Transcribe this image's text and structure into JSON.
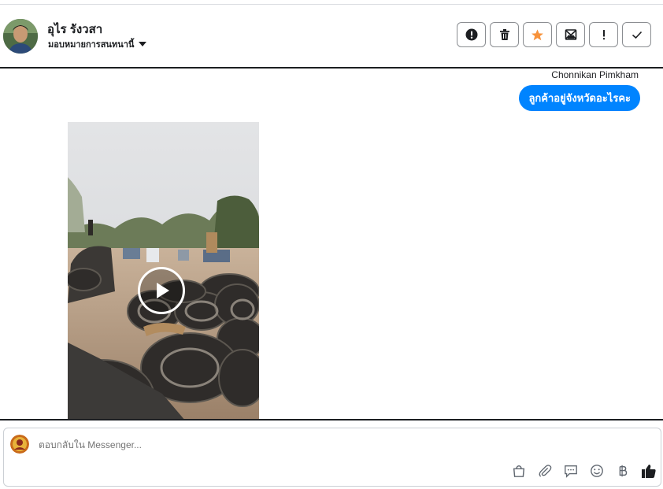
{
  "header": {
    "contact_name": "อุไร รังวสา",
    "assign_label": "มอบหมายการสนทนานี้",
    "actions": [
      {
        "name": "spam-icon"
      },
      {
        "name": "trash-icon"
      },
      {
        "name": "star-icon",
        "color": "#f7923b"
      },
      {
        "name": "mark-unread-icon"
      },
      {
        "name": "important-icon"
      },
      {
        "name": "check-icon"
      }
    ]
  },
  "conversation": {
    "sender_name": "Chonnikan Pimkham",
    "message_text": "ลูกค้าอยู่จังหวัดอะไรคะ",
    "message_color": "#0084ff",
    "attachment": {
      "type": "video"
    }
  },
  "composer": {
    "placeholder": "ตอบกลับใน Messenger...",
    "tools": [
      "shopping-bag-icon",
      "paperclip-icon",
      "chat-bubble-icon",
      "emoji-icon",
      "baht-icon",
      "thumbs-up-icon"
    ]
  }
}
